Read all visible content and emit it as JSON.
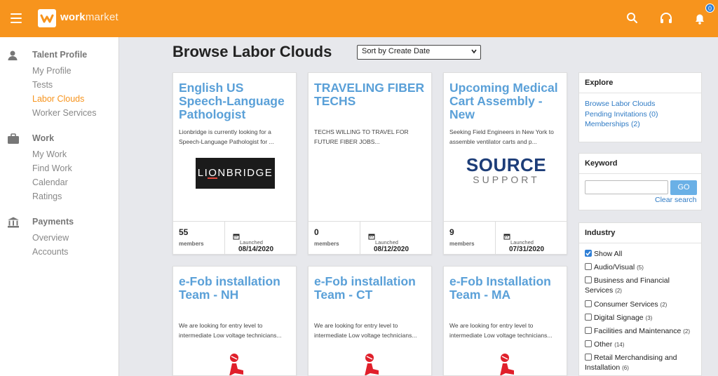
{
  "app": {
    "logo_bold": "work",
    "logo_light": "market"
  },
  "topbar": {
    "notification_count": "0",
    "icons": [
      "menu-icon",
      "search-icon",
      "headset-icon",
      "bell-icon"
    ]
  },
  "sidebar": {
    "talent": {
      "title": "Talent Profile",
      "links": [
        "My Profile",
        "Tests",
        "Labor Clouds",
        "Worker Services"
      ]
    },
    "work": {
      "title": "Work",
      "links": [
        "My Work",
        "Find Work",
        "Calendar",
        "Ratings"
      ]
    },
    "payments": {
      "title": "Payments",
      "links": [
        "Overview",
        "Accounts"
      ]
    }
  },
  "main": {
    "title": "Browse Labor Clouds",
    "sort_value": "Sort by Create Date",
    "cards": [
      {
        "title": "English US Speech-Language Pathologist",
        "desc": "Lionbridge is currently looking for a Speech-Language Pathologist for ...",
        "logo": "LIONBRIDGE",
        "members": "55",
        "members_label": "members",
        "launched_label": "Launched",
        "date": "08/14/2020"
      },
      {
        "title": "TRAVELING FIBER TECHS",
        "desc": "TECHS WILLING TO TRAVEL FOR FUTURE FIBER JOBS...",
        "members": "0",
        "members_label": "members",
        "launched_label": "Launched",
        "date": "08/12/2020"
      },
      {
        "title": "Upcoming Medical Cart Assembly - New",
        "desc": "Seeking Field Engineers in New York to assemble ventilator carts and p...",
        "logo_main": "SOURCE",
        "logo_sub": "SUPPORT",
        "members": "9",
        "members_label": "members",
        "launched_label": "Launched",
        "date": "07/31/2020"
      },
      {
        "title": "e-Fob installation Team - NH",
        "desc": "We are looking for entry level to intermediate Low voltage technicians..."
      },
      {
        "title": "e-Fob installation Team - CT",
        "desc": "We are looking for entry level to intermediate Low voltage technicians..."
      },
      {
        "title": "e-Fob Installation Team - MA",
        "desc": "We are looking for entry level to intermediate Low voltage technicians..."
      }
    ]
  },
  "explore": {
    "title": "Explore",
    "links": [
      "Browse Labor Clouds",
      "Pending Invitations (0)",
      "Memberships (2)"
    ]
  },
  "keyword": {
    "title": "Keyword",
    "value": "",
    "go": "GO",
    "clear": "Clear search"
  },
  "industry": {
    "title": "Industry",
    "items": [
      {
        "label": "Show All",
        "count": "",
        "checked": true
      },
      {
        "label": "Audio/Visual",
        "count": "(5)",
        "checked": false
      },
      {
        "label": "Business and Financial Services",
        "count": "(2)",
        "checked": false
      },
      {
        "label": "Consumer Services",
        "count": "(2)",
        "checked": false
      },
      {
        "label": "Digital Signage",
        "count": "(3)",
        "checked": false
      },
      {
        "label": "Facilities and Maintenance",
        "count": "(2)",
        "checked": false
      },
      {
        "label": "Other",
        "count": "(14)",
        "checked": false
      },
      {
        "label": "Retail Merchandising and Installation",
        "count": "(6)",
        "checked": false
      }
    ]
  },
  "colors": {
    "brand": "#f7941d",
    "link": "#2e7ac4",
    "card_title": "#5aa0d8"
  }
}
